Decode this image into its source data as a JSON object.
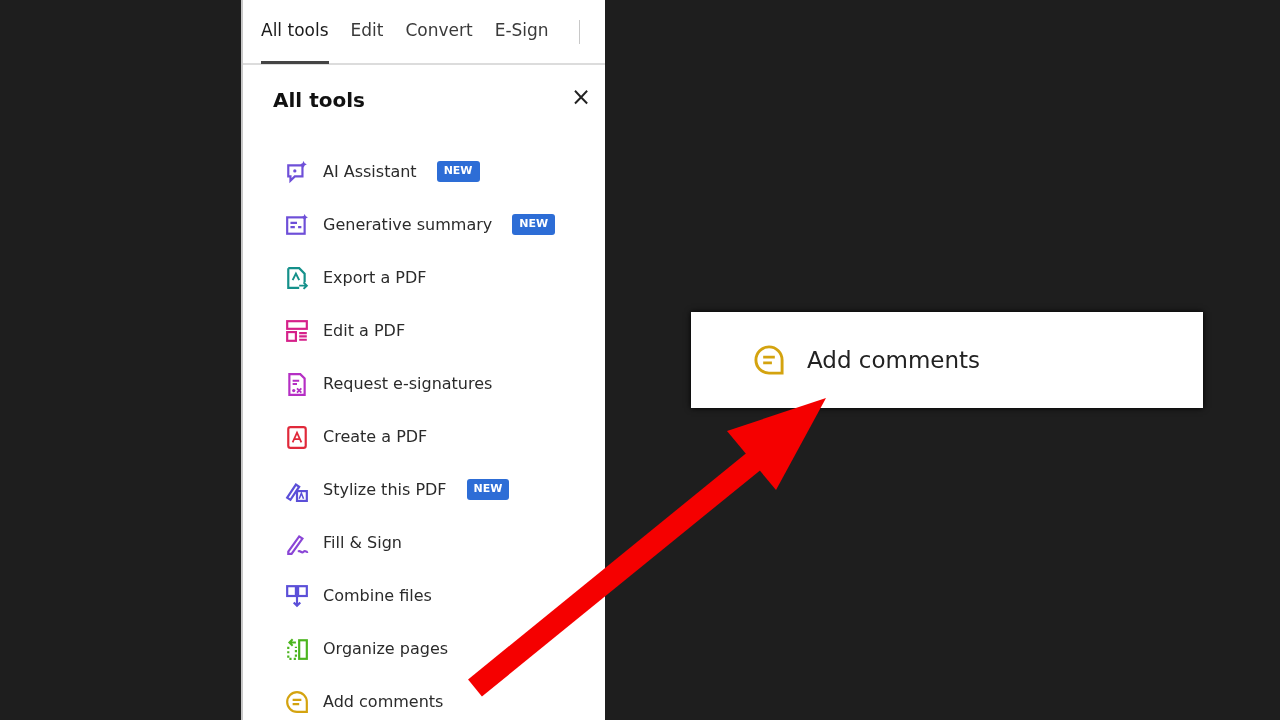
{
  "tabs": [
    {
      "label": "All tools",
      "selected": true
    },
    {
      "label": "Edit",
      "selected": false
    },
    {
      "label": "Convert",
      "selected": false
    },
    {
      "label": "E-Sign",
      "selected": false
    }
  ],
  "panel": {
    "title": "All tools",
    "close": "×"
  },
  "tools": [
    {
      "label": "AI Assistant",
      "badge": "NEW",
      "color": "#6e4fd8"
    },
    {
      "label": "Generative summary",
      "badge": "NEW",
      "color": "#6e4fd8"
    },
    {
      "label": "Export a PDF",
      "color": "#14908a"
    },
    {
      "label": "Edit a PDF",
      "color": "#d6218a"
    },
    {
      "label": "Request e-signatures",
      "color": "#b52fc4"
    },
    {
      "label": "Create a PDF",
      "color": "#e0293a"
    },
    {
      "label": "Stylize this PDF",
      "badge": "NEW",
      "color": "#5b4fd8"
    },
    {
      "label": "Fill & Sign",
      "color": "#8a45d6"
    },
    {
      "label": "Combine files",
      "color": "#5b4fd8"
    },
    {
      "label": "Organize pages",
      "color": "#4cb51f"
    },
    {
      "label": "Add comments",
      "color": "#d4a30f"
    }
  ],
  "callout": {
    "label": "Add comments"
  }
}
